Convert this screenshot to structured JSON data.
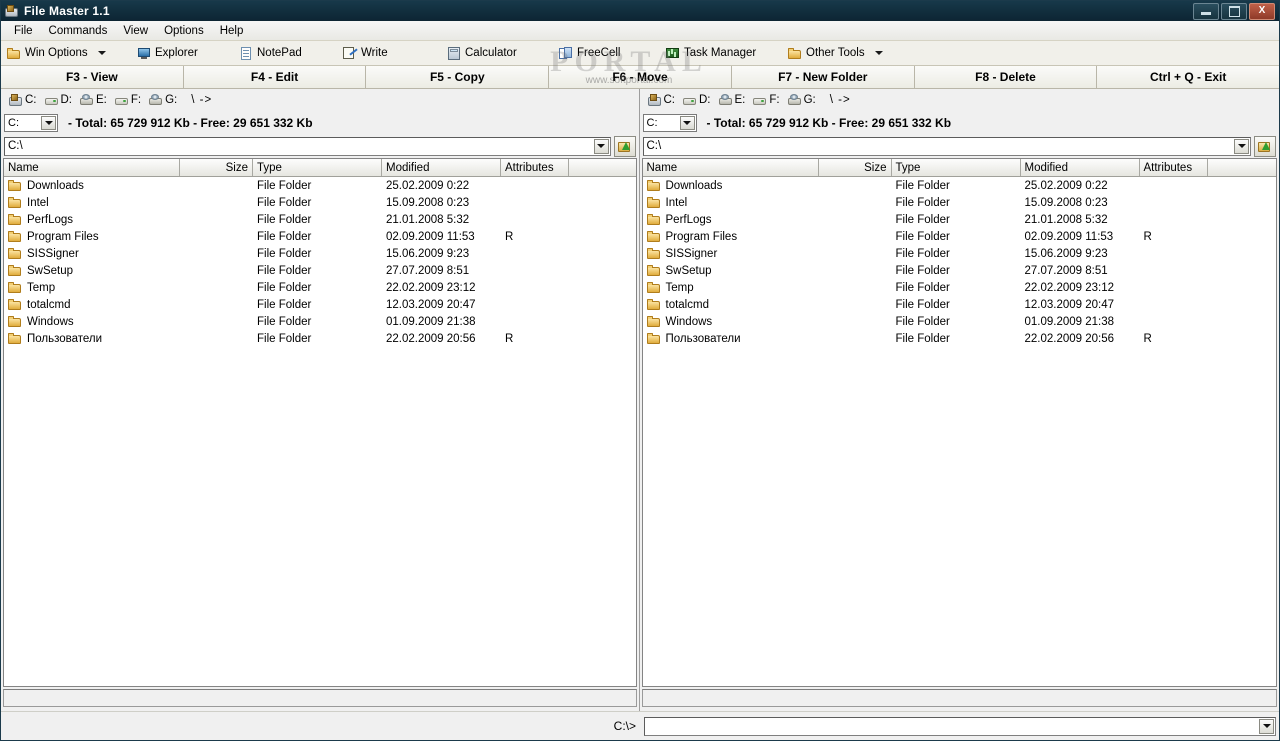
{
  "window": {
    "title": "File Master 1.1",
    "icon": "app-icon",
    "buttons": {
      "minimize": "_",
      "maximize": "❐",
      "close": "X"
    }
  },
  "menu": {
    "items": [
      "File",
      "Commands",
      "View",
      "Options",
      "Help"
    ]
  },
  "toolbar": {
    "items": [
      {
        "label": "Win Options",
        "icon": "folder",
        "caret": true
      },
      {
        "label": "Explorer",
        "icon": "monitor",
        "caret": false
      },
      {
        "label": "NotePad",
        "icon": "note",
        "caret": false
      },
      {
        "label": "Write",
        "icon": "write",
        "caret": false
      },
      {
        "label": "Calculator",
        "icon": "calc",
        "caret": false
      },
      {
        "label": "FreeCell",
        "icon": "cards",
        "caret": false
      },
      {
        "label": "Task Manager",
        "icon": "taskmgr",
        "caret": false
      },
      {
        "label": "Other Tools",
        "icon": "folder",
        "caret": true
      }
    ]
  },
  "watermark": {
    "big": "PORTAL",
    "small": "www.softportal.com"
  },
  "function_keys": [
    "F3 - View",
    "F4 - Edit",
    "F5 - Copy",
    "F6 - Move",
    "F7 - New Folder",
    "F8 - Delete",
    "Ctrl + Q - Exit"
  ],
  "panels": [
    {
      "id": "left",
      "drives": [
        {
          "letter": "C:",
          "icon": "netdrive"
        },
        {
          "letter": "D:",
          "icon": "drive"
        },
        {
          "letter": "E:",
          "icon": "hdd"
        },
        {
          "letter": "F:",
          "icon": "drive"
        },
        {
          "letter": "G:",
          "icon": "hdd"
        }
      ],
      "root_button": "\\ ->",
      "selected_drive": "C:",
      "drive_stats": "- Total: 65 729 912 Kb - Free: 29 651 332 Kb",
      "path": "C:\\",
      "columns": [
        "Name",
        "Size",
        "Type",
        "Modified",
        "Attributes"
      ],
      "rows": [
        {
          "name": "Downloads",
          "size": "",
          "type": "File Folder",
          "modified": "25.02.2009 0:22",
          "attributes": ""
        },
        {
          "name": "Intel",
          "size": "",
          "type": "File Folder",
          "modified": "15.09.2008 0:23",
          "attributes": ""
        },
        {
          "name": "PerfLogs",
          "size": "",
          "type": "File Folder",
          "modified": "21.01.2008 5:32",
          "attributes": ""
        },
        {
          "name": "Program Files",
          "size": "",
          "type": "File Folder",
          "modified": "02.09.2009 11:53",
          "attributes": "R"
        },
        {
          "name": "SISSigner",
          "size": "",
          "type": "File Folder",
          "modified": "15.06.2009 9:23",
          "attributes": ""
        },
        {
          "name": "SwSetup",
          "size": "",
          "type": "File Folder",
          "modified": "27.07.2009 8:51",
          "attributes": ""
        },
        {
          "name": "Temp",
          "size": "",
          "type": "File Folder",
          "modified": "22.02.2009 23:12",
          "attributes": ""
        },
        {
          "name": "totalcmd",
          "size": "",
          "type": "File Folder",
          "modified": "12.03.2009 20:47",
          "attributes": ""
        },
        {
          "name": "Windows",
          "size": "",
          "type": "File Folder",
          "modified": "01.09.2009 21:38",
          "attributes": ""
        },
        {
          "name": "Пользователи",
          "size": "",
          "type": "File Folder",
          "modified": "22.02.2009 20:56",
          "attributes": "R"
        }
      ]
    },
    {
      "id": "right",
      "drives": [
        {
          "letter": "C:",
          "icon": "netdrive"
        },
        {
          "letter": "D:",
          "icon": "drive"
        },
        {
          "letter": "E:",
          "icon": "hdd"
        },
        {
          "letter": "F:",
          "icon": "drive"
        },
        {
          "letter": "G:",
          "icon": "hdd"
        }
      ],
      "root_button": "\\ ->",
      "selected_drive": "C:",
      "drive_stats": "- Total: 65 729 912 Kb - Free: 29 651 332 Kb",
      "path": "C:\\",
      "columns": [
        "Name",
        "Size",
        "Type",
        "Modified",
        "Attributes"
      ],
      "rows": [
        {
          "name": "Downloads",
          "size": "",
          "type": "File Folder",
          "modified": "25.02.2009 0:22",
          "attributes": ""
        },
        {
          "name": "Intel",
          "size": "",
          "type": "File Folder",
          "modified": "15.09.2008 0:23",
          "attributes": ""
        },
        {
          "name": "PerfLogs",
          "size": "",
          "type": "File Folder",
          "modified": "21.01.2008 5:32",
          "attributes": ""
        },
        {
          "name": "Program Files",
          "size": "",
          "type": "File Folder",
          "modified": "02.09.2009 11:53",
          "attributes": "R"
        },
        {
          "name": "SISSigner",
          "size": "",
          "type": "File Folder",
          "modified": "15.06.2009 9:23",
          "attributes": ""
        },
        {
          "name": "SwSetup",
          "size": "",
          "type": "File Folder",
          "modified": "27.07.2009 8:51",
          "attributes": ""
        },
        {
          "name": "Temp",
          "size": "",
          "type": "File Folder",
          "modified": "22.02.2009 23:12",
          "attributes": ""
        },
        {
          "name": "totalcmd",
          "size": "",
          "type": "File Folder",
          "modified": "12.03.2009 20:47",
          "attributes": ""
        },
        {
          "name": "Windows",
          "size": "",
          "type": "File Folder",
          "modified": "01.09.2009 21:38",
          "attributes": ""
        },
        {
          "name": "Пользователи",
          "size": "",
          "type": "File Folder",
          "modified": "22.02.2009 20:56",
          "attributes": "R"
        }
      ]
    }
  ],
  "command_line": {
    "prompt": "C:\\>",
    "value": ""
  },
  "colors": {
    "titlebar": "#12303f",
    "close_button": "#a8452f",
    "chrome": "#f0f0f0",
    "list_background": "#ffffff",
    "folder_icon": "#e0ac3d"
  }
}
